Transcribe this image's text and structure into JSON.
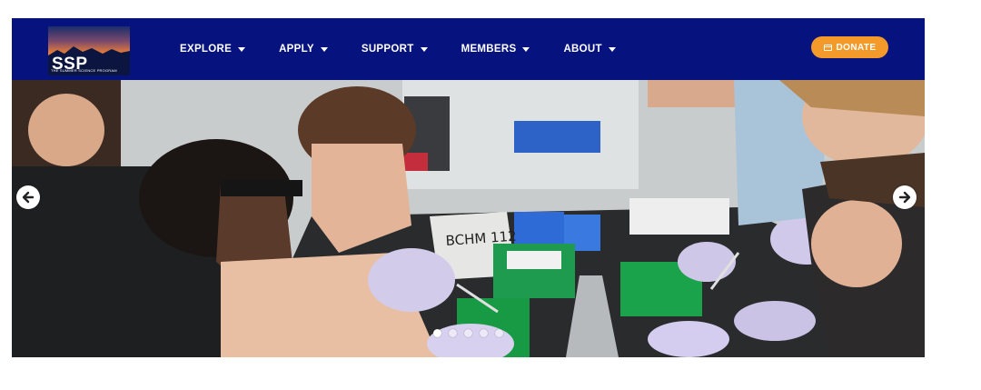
{
  "logo": {
    "text": "SSP",
    "subtitle": "THE SUMMER SCIENCE PROGRAM"
  },
  "nav": {
    "items": [
      {
        "label": "EXPLORE"
      },
      {
        "label": "APPLY"
      },
      {
        "label": "SUPPORT"
      },
      {
        "label": "MEMBERS"
      },
      {
        "label": "ABOUT"
      }
    ]
  },
  "donate": {
    "label": "DONATE",
    "color": "#f39a2b"
  },
  "colors": {
    "navbar": "#06127e",
    "accent": "#f39a2b"
  },
  "carousel": {
    "slide_count": 5,
    "active_index": 0,
    "prev_icon": "arrow-left-icon",
    "next_icon": "arrow-right-icon",
    "photo_label": "BCHM 112"
  }
}
